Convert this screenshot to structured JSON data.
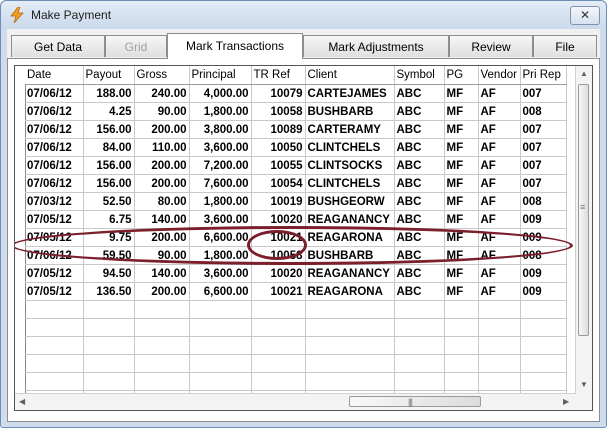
{
  "window": {
    "title": "Make Payment",
    "close_glyph": "✕"
  },
  "tabs": [
    {
      "label": "Get Data",
      "state": "normal"
    },
    {
      "label": "Grid",
      "state": "disabled"
    },
    {
      "label": "Mark Transactions",
      "state": "active"
    },
    {
      "label": "Mark Adjustments",
      "state": "normal"
    },
    {
      "label": "Review",
      "state": "normal"
    },
    {
      "label": "File",
      "state": "normal"
    }
  ],
  "grid": {
    "columns": [
      "Date",
      "Payout",
      "Gross",
      "Principal",
      "TR Ref",
      "Client",
      "Symbol",
      "PG",
      "Vendor",
      "Pri Rep"
    ],
    "rows": [
      [
        "07/06/12",
        "188.00",
        "240.00",
        "4,000.00",
        "10079",
        "CARTEJAMES",
        "ABC",
        "MF",
        "AF",
        "007"
      ],
      [
        "07/06/12",
        "4.25",
        "90.00",
        "1,800.00",
        "10058",
        "BUSHBARB",
        "ABC",
        "MF",
        "AF",
        "008"
      ],
      [
        "07/06/12",
        "156.00",
        "200.00",
        "3,800.00",
        "10089",
        "CARTERAMY",
        "ABC",
        "MF",
        "AF",
        "007"
      ],
      [
        "07/06/12",
        "84.00",
        "110.00",
        "3,600.00",
        "10050",
        "CLINTCHELS",
        "ABC",
        "MF",
        "AF",
        "007"
      ],
      [
        "07/06/12",
        "156.00",
        "200.00",
        "7,200.00",
        "10055",
        "CLINTSOCKS",
        "ABC",
        "MF",
        "AF",
        "007"
      ],
      [
        "07/06/12",
        "156.00",
        "200.00",
        "7,600.00",
        "10054",
        "CLINTCHELS",
        "ABC",
        "MF",
        "AF",
        "007"
      ],
      [
        "07/03/12",
        "52.50",
        "80.00",
        "1,800.00",
        "10019",
        "BUSHGEORW",
        "ABC",
        "MF",
        "AF",
        "008"
      ],
      [
        "07/05/12",
        "6.75",
        "140.00",
        "3,600.00",
        "10020",
        "REAGANANCY",
        "ABC",
        "MF",
        "AF",
        "009"
      ],
      [
        "07/05/12",
        "9.75",
        "200.00",
        "6,600.00",
        "10021",
        "REAGARONA",
        "ABC",
        "MF",
        "AF",
        "009"
      ],
      [
        "07/06/12",
        "59.50",
        "90.00",
        "1,800.00",
        "10058",
        "BUSHBARB",
        "ABC",
        "MF",
        "AF",
        "008"
      ],
      [
        "07/05/12",
        "94.50",
        "140.00",
        "3,600.00",
        "10020",
        "REAGANANCY",
        "ABC",
        "MF",
        "AF",
        "009"
      ],
      [
        "07/05/12",
        "136.50",
        "200.00",
        "6,600.00",
        "10021",
        "REAGARONA",
        "ABC",
        "MF",
        "AF",
        "009"
      ]
    ],
    "empty_rows": 7,
    "highlighted_row_index": 6,
    "highlighted_cell": "10019"
  },
  "icons": {
    "app": "lightning-bolt-icon",
    "scroll_grip": "grip-icon"
  },
  "colors": {
    "annotation_ring": "#7a1f2b",
    "title_bar": "#cbd9eb"
  }
}
